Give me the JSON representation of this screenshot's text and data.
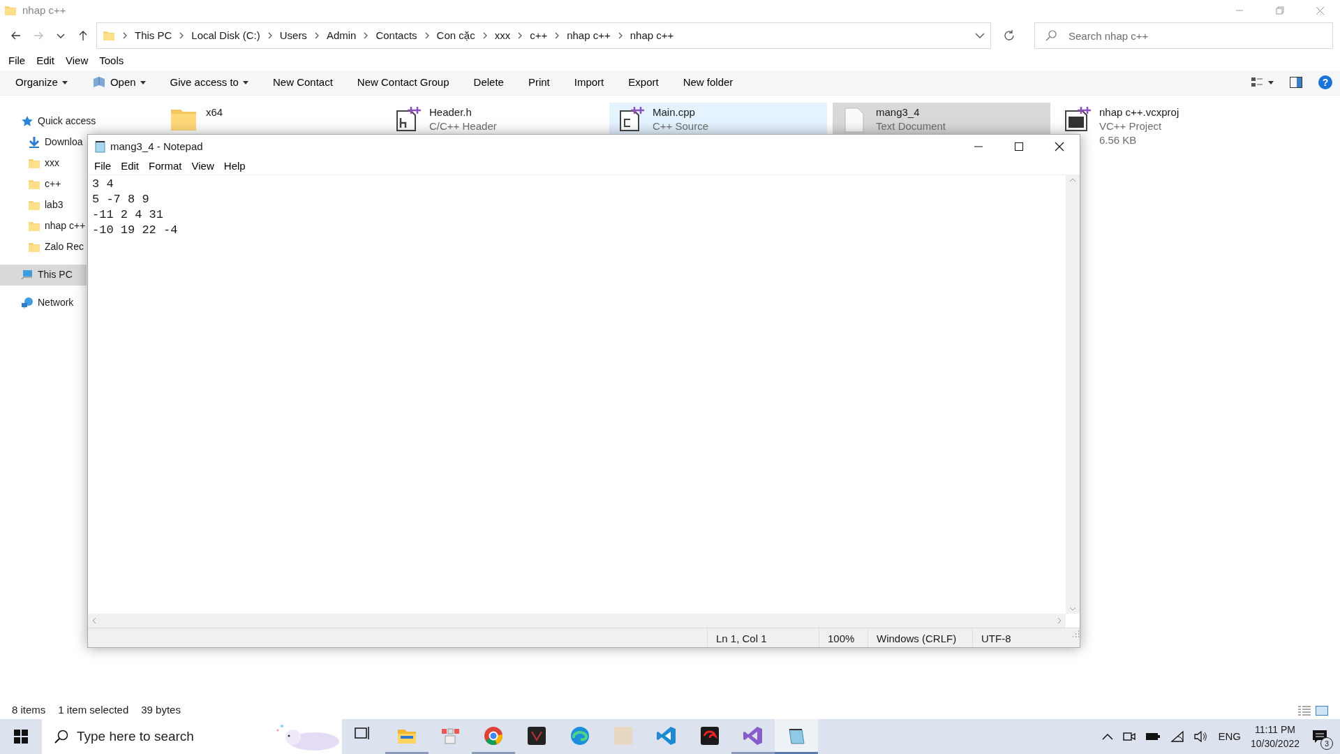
{
  "explorer": {
    "title": "nhap c++",
    "breadcrumb": [
      "This PC",
      "Local Disk (C:)",
      "Users",
      "Admin",
      "Contacts",
      "Con cặc",
      "xxx",
      "c++",
      "nhap c++",
      "nhap c++"
    ],
    "search": {
      "placeholder": "Search nhap c++"
    },
    "menu": [
      "File",
      "Edit",
      "View",
      "Tools"
    ],
    "commands": [
      {
        "label": "Organize",
        "dropdown": true,
        "icon": false
      },
      {
        "label": "Open",
        "dropdown": true,
        "icon": true
      },
      {
        "label": "Give access to",
        "dropdown": true,
        "icon": false
      },
      {
        "label": "New Contact",
        "dropdown": false,
        "icon": false
      },
      {
        "label": "New Contact Group",
        "dropdown": false,
        "icon": false
      },
      {
        "label": "Delete",
        "dropdown": false,
        "icon": false
      },
      {
        "label": "Print",
        "dropdown": false,
        "icon": false
      },
      {
        "label": "Import",
        "dropdown": false,
        "icon": false
      },
      {
        "label": "Export",
        "dropdown": false,
        "icon": false
      },
      {
        "label": "New folder",
        "dropdown": false,
        "icon": false
      }
    ],
    "help_label": "?",
    "sidebar": [
      {
        "kind": "star",
        "label": "Quick access",
        "selected": false,
        "children": [
          {
            "kind": "download",
            "label": "Downloa",
            "selected": false
          },
          {
            "kind": "folder",
            "label": "xxx",
            "selected": false
          },
          {
            "kind": "folder",
            "label": "c++",
            "selected": false
          },
          {
            "kind": "folder",
            "label": "lab3",
            "selected": false
          },
          {
            "kind": "folder",
            "label": "nhap c++",
            "selected": false
          },
          {
            "kind": "folder",
            "label": "Zalo Rec",
            "selected": false
          }
        ]
      },
      {
        "kind": "pc",
        "label": "This PC",
        "selected": true
      },
      {
        "kind": "network",
        "label": "Network",
        "selected": false
      }
    ],
    "files": [
      {
        "kind": "folder",
        "name": "x64",
        "selected": false,
        "hovered": false
      },
      {
        "kind": "header",
        "name": "Header.h",
        "details": [
          "C/C++ Header"
        ],
        "selected": false,
        "hovered": false
      },
      {
        "kind": "source",
        "name": "Main.cpp",
        "details": [
          "C++ Source"
        ],
        "selected": false,
        "hovered": true
      },
      {
        "kind": "text",
        "name": "mang3_4",
        "details": [
          "Text Document"
        ],
        "selected": true,
        "hovered": false
      },
      {
        "kind": "project",
        "name": "nhap c++.vcxproj",
        "details": [
          "VC++ Project",
          "6.56 KB"
        ],
        "selected": false,
        "hovered": false
      }
    ],
    "status": [
      "8 items",
      "1 item selected",
      "39 bytes"
    ]
  },
  "notepad": {
    "title": "mang3_4 - Notepad",
    "menu": [
      "File",
      "Edit",
      "Format",
      "View",
      "Help"
    ],
    "lines": [
      "3 4",
      "5 -7 8 9",
      "-11 2 4 31",
      "-10 19 22 -4"
    ],
    "status": [
      "Ln 1, Col 1",
      "100%",
      "Windows (CRLF)",
      "UTF-8"
    ]
  },
  "taskbar": {
    "search_placeholder": "Type here to search",
    "apps": [
      {
        "kind": "taskview",
        "running": false,
        "selected": false
      },
      {
        "kind": "explorer",
        "running": true,
        "selected": false
      },
      {
        "kind": "grid",
        "running": false,
        "selected": false
      },
      {
        "kind": "chrome",
        "running": true,
        "selected": false
      },
      {
        "kind": "dark",
        "running": false,
        "selected": false
      },
      {
        "kind": "edge",
        "running": false,
        "selected": false
      },
      {
        "kind": "photo",
        "running": false,
        "selected": false
      },
      {
        "kind": "vscode",
        "running": false,
        "selected": false
      },
      {
        "kind": "red",
        "running": false,
        "selected": false
      },
      {
        "kind": "vs",
        "running": true,
        "selected": false
      },
      {
        "kind": "notepad",
        "running": true,
        "selected": true
      }
    ],
    "language": "ENG",
    "time": "11:11 PM",
    "date": "10/30/2022",
    "notifications": "3"
  }
}
